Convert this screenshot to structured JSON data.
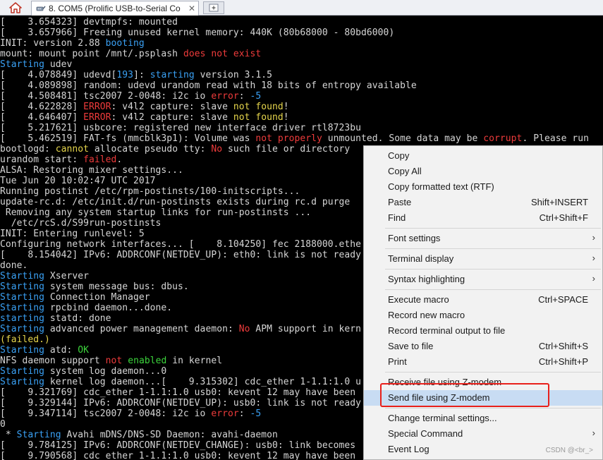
{
  "app": {
    "tab_title": "8. COM5 (Prolific USB-to-Serial Co",
    "tab_close": "✕",
    "home_icon": "house-icon",
    "tab_icon": "serial-port-icon",
    "new_tab_icon": "new-tab-icon"
  },
  "colors": {
    "background": "#000000",
    "text": "#d6d6d6",
    "blue": "#3aa1f5",
    "red": "#ee3b3b",
    "yellow": "#e6d64c",
    "green": "#3cd43c",
    "menu_highlight": "#c8dcf3",
    "annotation": "#e8201b"
  },
  "terminal": {
    "lines": [
      [
        {
          "t": "[    3.654323] devtmpfs: mounted"
        }
      ],
      [
        {
          "t": "[    3.657966] Freeing unused kernel memory: 440K (80b68000 - 80bd6000)"
        }
      ],
      [
        {
          "t": "INIT: version 2.88 "
        },
        {
          "t": "booting",
          "c": "blue"
        }
      ],
      [
        {
          "t": "mount: mount point /mnt/.psplash "
        },
        {
          "t": "does not exist",
          "c": "red"
        }
      ],
      [
        {
          "t": "Starting",
          "c": "blue"
        },
        {
          "t": " udev"
        }
      ],
      [
        {
          "t": "[    4.078849] udevd["
        },
        {
          "t": "193",
          "c": "blue"
        },
        {
          "t": "]: "
        },
        {
          "t": "starting",
          "c": "blue"
        },
        {
          "t": " version 3.1.5"
        }
      ],
      [
        {
          "t": "[    4.089898] random: udevd urandom read with 18 bits of entropy available"
        }
      ],
      [
        {
          "t": "[    4.508481] tsc2007 2-0048: i2c io "
        },
        {
          "t": "error",
          "c": "red"
        },
        {
          "t": ": "
        },
        {
          "t": "-5",
          "c": "blue"
        }
      ],
      [
        {
          "t": "[    4.622828] "
        },
        {
          "t": "ERROR",
          "c": "red"
        },
        {
          "t": ": v4l2 capture: slave "
        },
        {
          "t": "not found",
          "c": "yellow"
        },
        {
          "t": "!"
        }
      ],
      [
        {
          "t": "[    4.646407] "
        },
        {
          "t": "ERROR",
          "c": "red"
        },
        {
          "t": ": v4l2 capture: slave "
        },
        {
          "t": "not found",
          "c": "yellow"
        },
        {
          "t": "!"
        }
      ],
      [
        {
          "t": "[    5.217621] usbcore: registered new interface driver rtl8723bu"
        }
      ],
      [
        {
          "t": "[    5.462519] FAT-fs (mmcblk3p1): Volume was "
        },
        {
          "t": "not properly",
          "c": "red"
        },
        {
          "t": " unmounted. Some data may be "
        },
        {
          "t": "corrupt",
          "c": "red"
        },
        {
          "t": ". Please run"
        }
      ],
      [
        {
          "t": "bootlogd: "
        },
        {
          "t": "cannot",
          "c": "yellow"
        },
        {
          "t": " allocate pseudo tty: "
        },
        {
          "t": "No",
          "c": "red"
        },
        {
          "t": " such file or directory"
        }
      ],
      [
        {
          "t": "urandom start: "
        },
        {
          "t": "failed",
          "c": "red"
        },
        {
          "t": "."
        }
      ],
      [
        {
          "t": "ALSA: Restoring mixer settings..."
        }
      ],
      [
        {
          "t": "Tue Jun 20 10:02:47 UTC 2017"
        }
      ],
      [
        {
          "t": "Running postinst /etc/rpm-postinsts/100-initscripts..."
        }
      ],
      [
        {
          "t": "update-rc.d: /etc/init.d/run-postinsts exists during rc.d purge "
        }
      ],
      [
        {
          "t": " Removing any system startup links for run-postinsts ..."
        }
      ],
      [
        {
          "t": "  /etc/rcS.d/S99run-postinsts"
        }
      ],
      [
        {
          "t": "INIT: Entering runlevel: 5"
        }
      ],
      [
        {
          "t": "Configuring network interfaces... [    8.104250] fec 2188000.ethe"
        }
      ],
      [
        {
          "t": "[    8.154042] IPv6: ADDRCONF(NETDEV_UP): eth0: link is not ready"
        }
      ],
      [
        {
          "t": "done."
        }
      ],
      [
        {
          "t": "Starting",
          "c": "blue"
        },
        {
          "t": " Xserver"
        }
      ],
      [
        {
          "t": "Starting",
          "c": "blue"
        },
        {
          "t": " system message bus: dbus."
        }
      ],
      [
        {
          "t": "Starting",
          "c": "blue"
        },
        {
          "t": " Connection Manager"
        }
      ],
      [
        {
          "t": "Starting",
          "c": "blue"
        },
        {
          "t": " rpcbind daemon...done."
        }
      ],
      [
        {
          "t": "starting",
          "c": "blue"
        },
        {
          "t": " statd: done"
        }
      ],
      [
        {
          "t": "Starting",
          "c": "blue"
        },
        {
          "t": " advanced power management daemon: "
        },
        {
          "t": "No",
          "c": "red"
        },
        {
          "t": " APM support in kern"
        }
      ],
      [
        {
          "t": "(failed.)",
          "c": "yellow"
        }
      ],
      [
        {
          "t": "Starting",
          "c": "blue"
        },
        {
          "t": " atd: "
        },
        {
          "t": "OK",
          "c": "green"
        }
      ],
      [
        {
          "t": "NFS daemon support "
        },
        {
          "t": "not",
          "c": "red"
        },
        {
          "t": " "
        },
        {
          "t": "enabled",
          "c": "green"
        },
        {
          "t": " in kernel"
        }
      ],
      [
        {
          "t": "Starting",
          "c": "blue"
        },
        {
          "t": " system log daemon...0"
        }
      ],
      [
        {
          "t": "Starting",
          "c": "blue"
        },
        {
          "t": " kernel log daemon...[    9.315302] cdc_ether 1-1.1:1.0 u"
        }
      ],
      [
        {
          "t": "[    9.321769] cdc_ether 1-1.1:1.0 usb0: kevent 12 may have been"
        }
      ],
      [
        {
          "t": "[    9.329144] IPv6: ADDRCONF(NETDEV_UP): usb0: link is not ready"
        }
      ],
      [
        {
          "t": "[    9.347114] tsc2007 2-0048: i2c io "
        },
        {
          "t": "error",
          "c": "red"
        },
        {
          "t": ": "
        },
        {
          "t": "-5",
          "c": "blue"
        }
      ],
      [
        {
          "t": "0"
        }
      ],
      [
        {
          "t": " * "
        },
        {
          "t": "Starting",
          "c": "blue"
        },
        {
          "t": " Avahi mDNS/DNS-SD Daemon: avahi-daemon"
        }
      ],
      [
        {
          "t": "[    9.784125] IPv6: ADDRCONF(NETDEV_CHANGE): usb0: link becomes"
        }
      ],
      [
        {
          "t": "[    9.790568] cdc_ether 1-1.1:1.0 usb0: kevent 12 may have been"
        }
      ]
    ]
  },
  "context_menu": {
    "items": [
      {
        "label": "Copy"
      },
      {
        "label": "Copy All"
      },
      {
        "label": "Copy formatted text (RTF)"
      },
      {
        "label": "Paste",
        "shortcut": "Shift+INSERT"
      },
      {
        "label": "Find",
        "shortcut": "Ctrl+Shift+F"
      },
      {
        "sep": true
      },
      {
        "label": "Font settings",
        "submenu": true
      },
      {
        "sep": true
      },
      {
        "label": "Terminal display",
        "submenu": true
      },
      {
        "sep": true
      },
      {
        "label": "Syntax highlighting",
        "submenu": true
      },
      {
        "sep": true
      },
      {
        "label": "Execute macro",
        "shortcut": "Ctrl+SPACE"
      },
      {
        "label": "Record new macro"
      },
      {
        "label": "Record terminal output to file"
      },
      {
        "label": "Save to file",
        "shortcut": "Ctrl+Shift+S"
      },
      {
        "label": "Print",
        "shortcut": "Ctrl+Shift+P"
      },
      {
        "sep": true
      },
      {
        "label": "Receive file using Z-modem"
      },
      {
        "label": "Send file using Z-modem",
        "highlight": true
      },
      {
        "sep": true
      },
      {
        "label": "Change terminal settings..."
      },
      {
        "label": "Special Command",
        "submenu": true
      },
      {
        "label": "Event Log"
      }
    ],
    "submenu_icon": "chevron-right-icon"
  },
  "watermark": "CSDN @<br_>"
}
